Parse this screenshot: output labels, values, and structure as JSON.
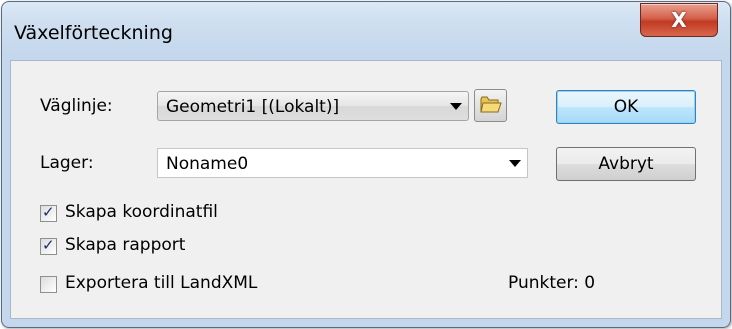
{
  "window": {
    "title": "Växelförteckning",
    "close_glyph": "X"
  },
  "form": {
    "vaglinje_label": "Väglinje:",
    "vaglinje_value": "Geometri1 [(Lokalt)]",
    "lager_label": "Lager:",
    "lager_value": "Noname0"
  },
  "buttons": {
    "ok": "OK",
    "cancel": "Avbryt"
  },
  "checkboxes": [
    {
      "label": "Skapa koordinatfil",
      "checked": true
    },
    {
      "label": "Skapa rapport",
      "checked": true
    },
    {
      "label": "Exportera till LandXML",
      "checked": false
    }
  ],
  "status": {
    "punkter": "Punkter: 0"
  },
  "icons": {
    "folder": "folder-icon",
    "close": "close-icon",
    "dropdown": "chevron-down-icon"
  },
  "colors": {
    "close_red": "#c23a23",
    "default_button_blue": "#3c7fb1"
  }
}
